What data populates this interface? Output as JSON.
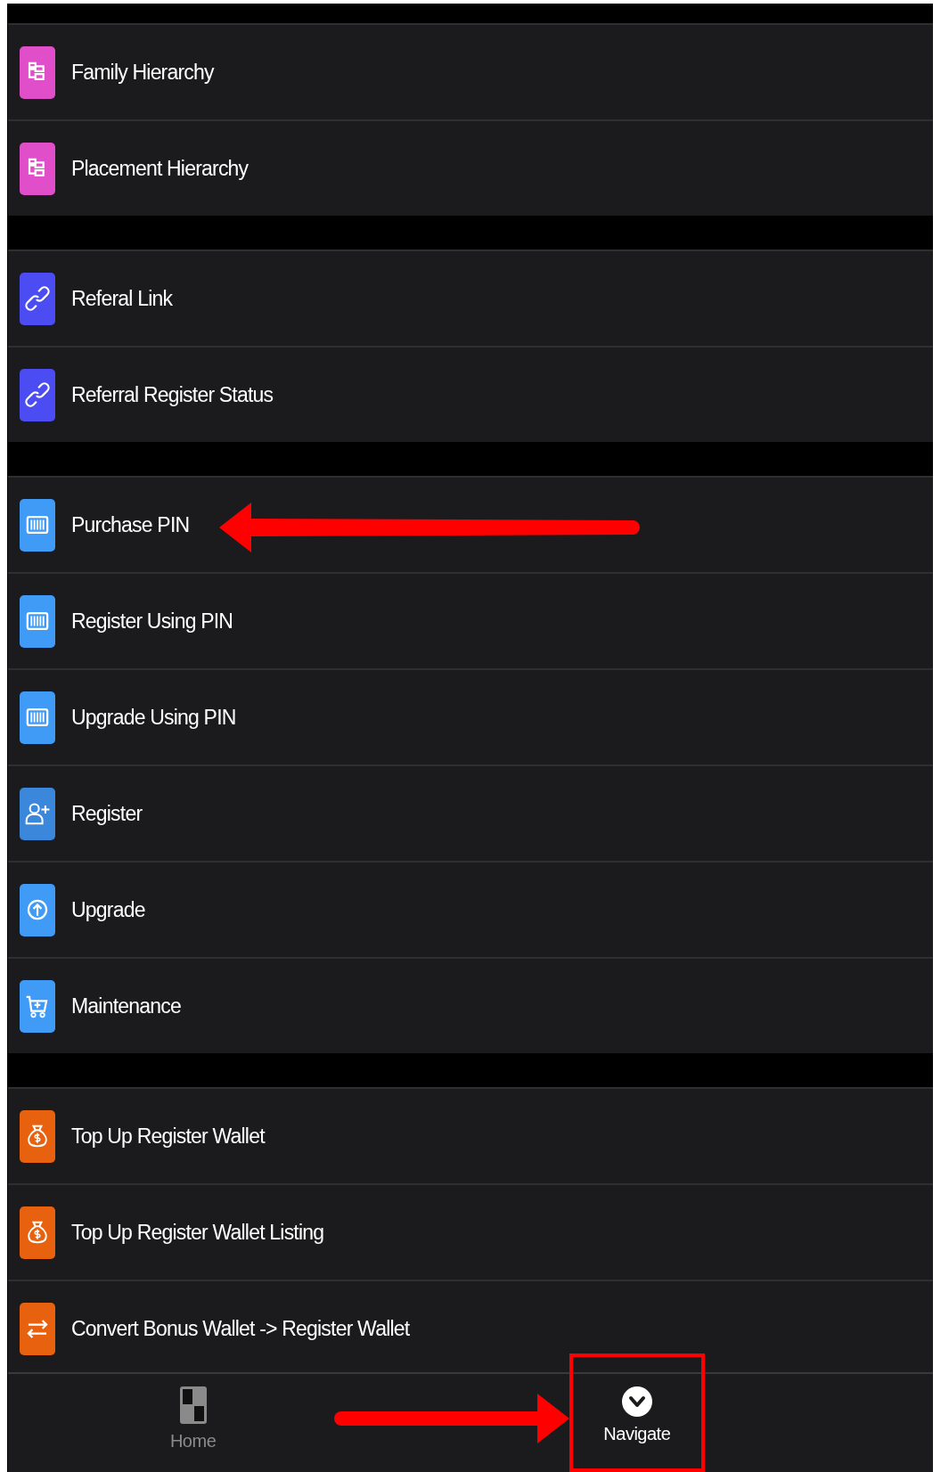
{
  "groups": [
    {
      "items": [
        {
          "label": "Family Hierarchy",
          "kind": "hierarchy",
          "color": "#e04fc9",
          "marked": false
        },
        {
          "label": "Placement Hierarchy",
          "kind": "hierarchy",
          "color": "#e04fc9",
          "marked": false
        }
      ]
    },
    {
      "items": [
        {
          "label": "Referal Link",
          "kind": "link",
          "color": "#4b4cf2",
          "marked": false
        },
        {
          "label": "Referral Register Status",
          "kind": "link",
          "color": "#4b4cf2",
          "marked": false
        }
      ]
    },
    {
      "items": [
        {
          "label": "Purchase PIN",
          "kind": "card",
          "color": "#3f9bf5",
          "marked": true
        },
        {
          "label": "Register Using PIN",
          "kind": "card",
          "color": "#3f9bf5",
          "marked": false
        },
        {
          "label": "Upgrade Using PIN",
          "kind": "card",
          "color": "#3f9bf5",
          "marked": false
        },
        {
          "label": "Register",
          "kind": "user",
          "color": "#3a87dc",
          "marked": false
        },
        {
          "label": "Upgrade",
          "kind": "upgrade",
          "color": "#3f9bf5",
          "marked": false
        },
        {
          "label": "Maintenance",
          "kind": "cart",
          "color": "#3f9bf5",
          "marked": false
        }
      ]
    },
    {
      "items": [
        {
          "label": "Top Up Register Wallet",
          "kind": "wallet",
          "color": "#e8610f",
          "marked": false
        },
        {
          "label": "Top Up Register Wallet Listing",
          "kind": "wallet",
          "color": "#e8610f",
          "marked": false
        },
        {
          "label": "Convert Bonus Wallet -> Register Wallet",
          "kind": "swap",
          "color": "#e8610f",
          "marked": false
        }
      ]
    }
  ],
  "bottom_nav": [
    {
      "label": "Home",
      "kind": "home",
      "selected": false,
      "marked": false
    },
    {
      "label": "Navigate",
      "kind": "chevron",
      "selected": true,
      "marked": true
    }
  ]
}
